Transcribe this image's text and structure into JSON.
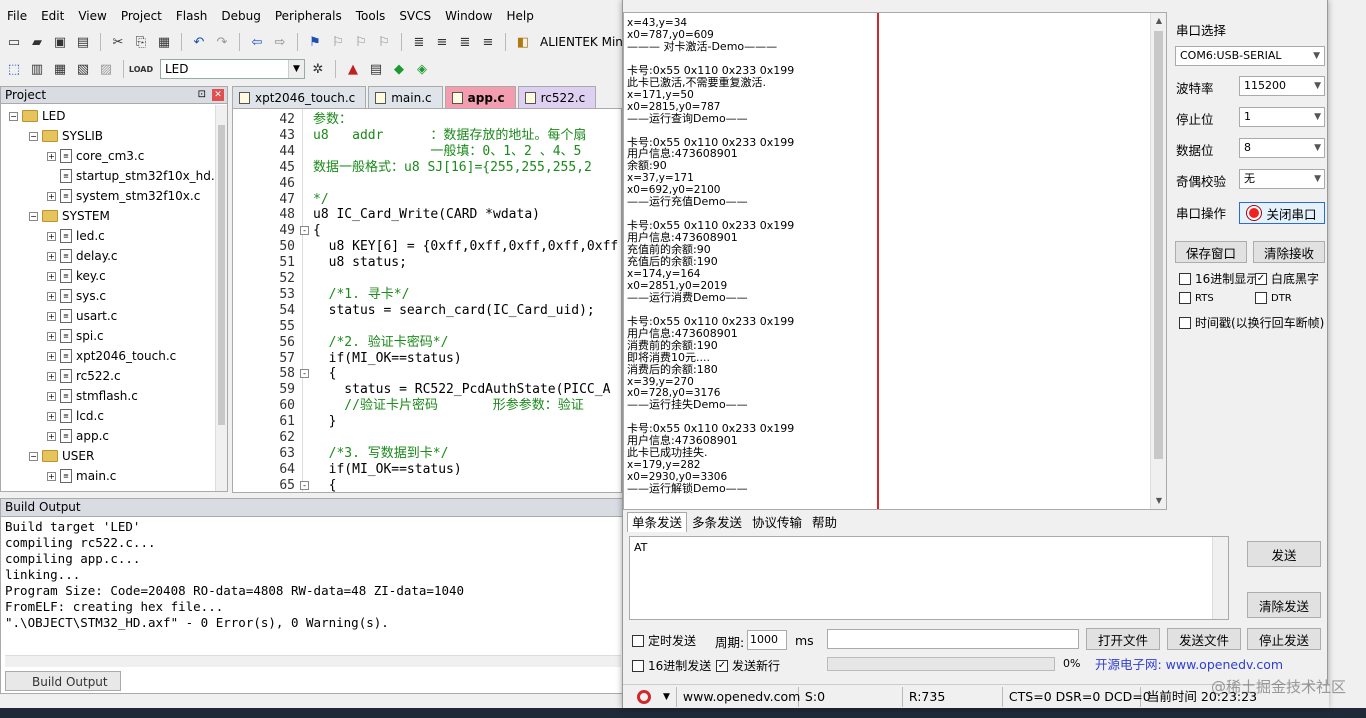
{
  "menu": [
    "File",
    "Edit",
    "View",
    "Project",
    "Flash",
    "Debug",
    "Peripherals",
    "Tools",
    "SVCS",
    "Window",
    "Help"
  ],
  "toolbar": {
    "project_label": "ALIENTEK Mini",
    "target": "LED"
  },
  "project_panel": {
    "title": "Project",
    "tree": [
      {
        "label": "LED",
        "kind": "root",
        "indent": 0
      },
      {
        "label": "SYSLIB",
        "kind": "folder",
        "indent": 1
      },
      {
        "label": "core_cm3.c",
        "kind": "file-exp",
        "indent": 2
      },
      {
        "label": "startup_stm32f10x_hd.s",
        "kind": "file",
        "indent": 2
      },
      {
        "label": "system_stm32f10x.c",
        "kind": "file-exp",
        "indent": 2
      },
      {
        "label": "SYSTEM",
        "kind": "folder",
        "indent": 1
      },
      {
        "label": "led.c",
        "kind": "file-exp",
        "indent": 2
      },
      {
        "label": "delay.c",
        "kind": "file-exp",
        "indent": 2
      },
      {
        "label": "key.c",
        "kind": "file-exp",
        "indent": 2
      },
      {
        "label": "sys.c",
        "kind": "file-exp",
        "indent": 2
      },
      {
        "label": "usart.c",
        "kind": "file-exp",
        "indent": 2
      },
      {
        "label": "spi.c",
        "kind": "file-exp",
        "indent": 2
      },
      {
        "label": "xpt2046_touch.c",
        "kind": "file-exp",
        "indent": 2
      },
      {
        "label": "rc522.c",
        "kind": "file-exp",
        "indent": 2
      },
      {
        "label": "stmflash.c",
        "kind": "file-exp",
        "indent": 2
      },
      {
        "label": "lcd.c",
        "kind": "file-exp",
        "indent": 2
      },
      {
        "label": "app.c",
        "kind": "file-exp",
        "indent": 2
      },
      {
        "label": "USER",
        "kind": "folder",
        "indent": 1
      },
      {
        "label": "main.c",
        "kind": "file-exp",
        "indent": 2
      }
    ]
  },
  "editor": {
    "tabs": [
      {
        "label": "xpt2046_touch.c",
        "state": "normal"
      },
      {
        "label": "main.c",
        "state": "normal"
      },
      {
        "label": "app.c",
        "state": "active"
      },
      {
        "label": "rc522.c",
        "state": "rc522"
      }
    ],
    "lines": [
      {
        "n": "42",
        "fold": "",
        "text": "参数：",
        "color": "green"
      },
      {
        "n": "43",
        "fold": "",
        "text": "u8   addr      ：数据存放的地址。每个扇",
        "color": "green"
      },
      {
        "n": "44",
        "fold": "",
        "text": "               一般填：0、1、2 、4、5",
        "color": "green"
      },
      {
        "n": "45",
        "fold": "",
        "text": "数据一般格式：u8 SJ[16]={255,255,255,2",
        "color": "green"
      },
      {
        "n": "46",
        "fold": "",
        "text": "",
        "color": "black"
      },
      {
        "n": "47",
        "fold": "",
        "text": "*/",
        "color": "green"
      },
      {
        "n": "48",
        "fold": "",
        "text": "u8 IC_Card_Write(CARD *wdata)",
        "color": "black"
      },
      {
        "n": "49",
        "fold": "-",
        "text": "{",
        "color": "black"
      },
      {
        "n": "50",
        "fold": "",
        "text": "  u8 KEY[6] = {0xff,0xff,0xff,0xff,0xff",
        "color": "black"
      },
      {
        "n": "51",
        "fold": "",
        "text": "  u8 status;",
        "color": "black"
      },
      {
        "n": "52",
        "fold": "",
        "text": "",
        "color": "black"
      },
      {
        "n": "53",
        "fold": "",
        "text": "  /*1. 寻卡*/",
        "color": "green"
      },
      {
        "n": "54",
        "fold": "",
        "text": "  status = search_card(IC_Card_uid);",
        "color": "black"
      },
      {
        "n": "55",
        "fold": "",
        "text": "",
        "color": "black"
      },
      {
        "n": "56",
        "fold": "",
        "text": "  /*2. 验证卡密码*/",
        "color": "green"
      },
      {
        "n": "57",
        "fold": "",
        "text": "  if(MI_OK==status)",
        "color": "black"
      },
      {
        "n": "58",
        "fold": "-",
        "text": "  {",
        "color": "black"
      },
      {
        "n": "59",
        "fold": "",
        "text": "    status = RC522_PcdAuthState(PICC_A",
        "color": "black"
      },
      {
        "n": "60",
        "fold": "",
        "text": "    //验证卡片密码       形参参数：验证",
        "color": "green"
      },
      {
        "n": "61",
        "fold": "",
        "text": "  }",
        "color": "black"
      },
      {
        "n": "62",
        "fold": "",
        "text": "",
        "color": "black"
      },
      {
        "n": "63",
        "fold": "",
        "text": "  /*3. 写数据到卡*/",
        "color": "green"
      },
      {
        "n": "64",
        "fold": "",
        "text": "  if(MI_OK==status)",
        "color": "black"
      },
      {
        "n": "65",
        "fold": "-",
        "text": "  {",
        "color": "black"
      }
    ]
  },
  "build_output": {
    "title": "Build Output",
    "tab_label": "Build Output",
    "lines": [
      "Build target 'LED'",
      "compiling rc522.c...",
      "compiling app.c...",
      "linking...",
      "Program Size: Code=20408 RO-data=4808 RW-data=48 ZI-data=1040",
      "FromELF: creating hex file...",
      "\".\\OBJECT\\STM32_HD.axf\" - 0 Error(s), 0 Warning(s)."
    ]
  },
  "serial": {
    "received": [
      "x=43,y=34",
      "x0=787,y0=609",
      "——— 对卡激活-Demo———",
      "",
      "卡号:0x55 0x110 0x233 0x199",
      "此卡已激活,不需要重复激活.",
      "x=171,y=50",
      "x0=2815,y0=787",
      "——运行查询Demo——",
      "",
      "卡号:0x55 0x110 0x233 0x199",
      "用户信息:473608901",
      "余额:90",
      "x=37,y=171",
      "x0=692,y0=2100",
      "——运行充值Demo——",
      "",
      "卡号:0x55 0x110 0x233 0x199",
      "用户信息:473608901",
      "充值前的余额:90",
      "充值后的余额:190",
      "x=174,y=164",
      "x0=2851,y0=2019",
      "——运行消费Demo——",
      "",
      "卡号:0x55 0x110 0x233 0x199",
      "用户信息:473608901",
      "消费前的余额:190",
      "即将消费10元....",
      "消费后的余额:180",
      "x=39,y=270",
      "x0=728,y0=3176",
      "——运行挂失Demo——",
      "",
      "卡号:0x55 0x110 0x233 0x199",
      "用户信息:473608901",
      "此卡已成功挂失.",
      "x=179,y=282",
      "x0=2930,y0=3306",
      "——运行解锁Demo——"
    ],
    "port_label": "串口选择",
    "port_value": "COM6:USB-SERIAL",
    "baud_label": "波特率",
    "baud_value": "115200",
    "stop_label": "停止位",
    "stop_value": "1",
    "data_label": "数据位",
    "data_value": "8",
    "parity_label": "奇偶校验",
    "parity_value": "无",
    "op_label": "串口操作",
    "close_port": "关闭串口",
    "save_window": "保存窗口",
    "clear_recv": "清除接收",
    "hex_display": "16进制显示",
    "white_bg": "白底黑字",
    "rts": "RTS",
    "dtr": "DTR",
    "timestamp": "时间戳(以换行回车断帧)",
    "send_tabs": [
      "单条发送",
      "多条发送",
      "协议传输",
      "帮助"
    ],
    "send_text": "AT",
    "send_btn": "发送",
    "clear_send": "清除发送",
    "timed_send": "定时发送",
    "period_label": "周期:",
    "period_value": "1000",
    "ms": "ms",
    "open_file": "打开文件",
    "send_file": "发送文件",
    "stop_send": "停止发送",
    "hex_send": "16进制发送",
    "send_newline": "发送新行",
    "progress_pct": "0%",
    "link": "开源电子网: www.openedv.com",
    "status": {
      "site": "www.openedv.com",
      "s": "S:0",
      "r": "R:735",
      "signals": "CTS=0 DSR=0 DCD=0",
      "time": "当前时间 20:23:23"
    },
    "watermark": "@稀土掘金技术社区"
  }
}
